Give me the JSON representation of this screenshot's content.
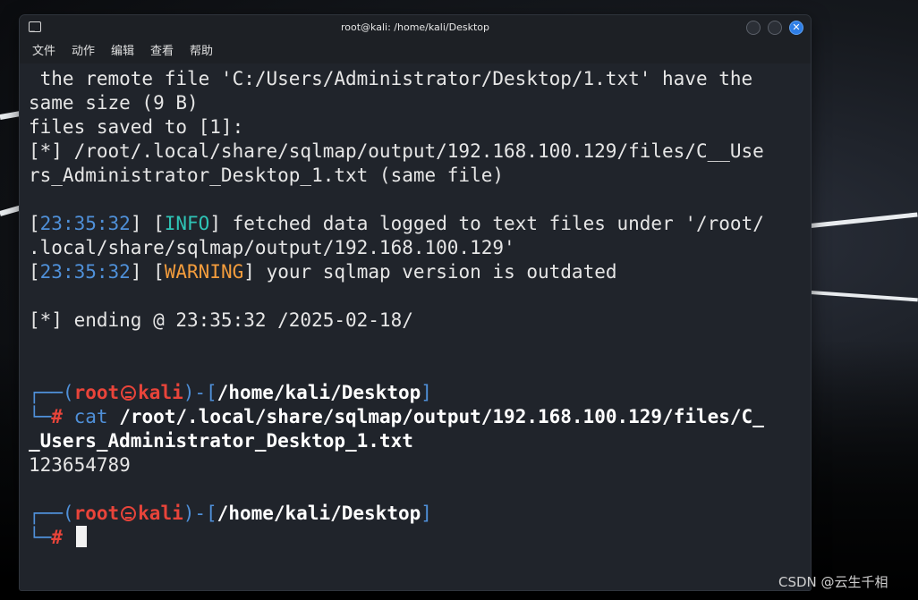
{
  "window": {
    "title": "root@kali: /home/kali/Desktop",
    "close_glyph": "✕"
  },
  "menu": [
    "文件",
    "动作",
    "编辑",
    "查看",
    "帮助"
  ],
  "terminal": {
    "lines": [
      " the remote file 'C:/Users/Administrator/Desktop/1.txt' have the",
      "same size (9 B)",
      "files saved to [1]:",
      "[*] /root/.local/share/sqlmap/output/192.168.100.129/files/C__Use",
      "rs_Administrator_Desktop_1.txt (same file)"
    ],
    "info": {
      "time": "23:35:32",
      "level": "INFO",
      "text": " fetched data logged to text files under '/root/",
      "continuation": ".local/share/sqlmap/output/192.168.100.129'"
    },
    "warning": {
      "time": "23:35:32",
      "level": "WARNING",
      "text": " your sqlmap version is outdated"
    },
    "ending": "[*] ending @ 23:35:32 /2025-02-18/",
    "prompt1": {
      "user": "root",
      "host": "kali",
      "path": "/home/kali/Desktop",
      "cmd": "cat",
      "arg": " /root/.local/share/sqlmap/output/192.168.100.129/files/C_",
      "arg2": "_Users_Administrator_Desktop_1.txt"
    },
    "output": "123654789",
    "prompt2": {
      "user": "root",
      "host": "kali",
      "path": "/home/kali/Desktop"
    }
  },
  "watermark": "CSDN @云生千相",
  "colors": {
    "prompt_frame": "#4f90d9",
    "prompt_user": "#e8443a",
    "timestamp": "#4f90d9",
    "info": "#2ec4b6",
    "warning": "#f39c3c",
    "close_button": "#2e7ee6"
  }
}
